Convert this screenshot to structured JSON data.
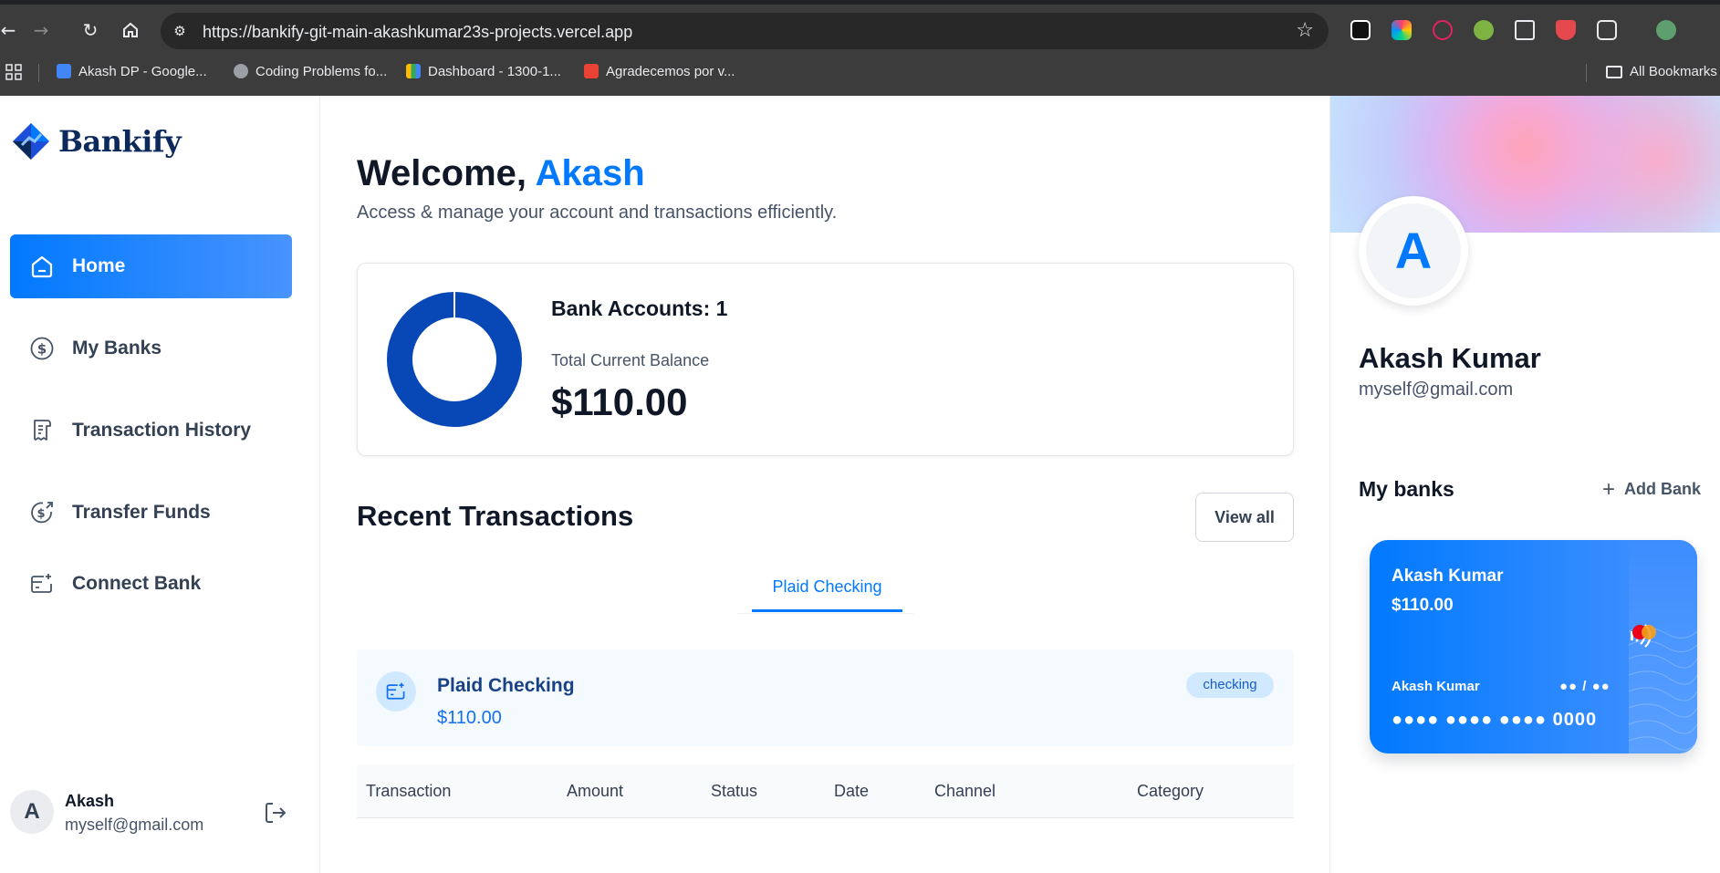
{
  "browser": {
    "url": "https://bankify-git-main-akashkumar23s-projects.vercel.app",
    "bookmarks": [
      {
        "label": "Akash DP - Google..."
      },
      {
        "label": "Coding Problems fo..."
      },
      {
        "label": "Dashboard - 1300-1..."
      },
      {
        "label": "Agradecemos por v..."
      }
    ],
    "all_bookmarks": "All Bookmarks"
  },
  "sidebar": {
    "brand": "Bankify",
    "items": [
      {
        "label": "Home",
        "icon": "home-icon",
        "active": true
      },
      {
        "label": "My Banks",
        "icon": "dollar-circle-icon"
      },
      {
        "label": "Transaction History",
        "icon": "receipt-icon"
      },
      {
        "label": "Transfer Funds",
        "icon": "money-send-icon"
      },
      {
        "label": "Connect Bank",
        "icon": "card-add-icon"
      }
    ],
    "user": {
      "initial": "A",
      "name": "Akash",
      "email": "myself@gmail.com"
    }
  },
  "main": {
    "greeting": "Welcome,",
    "user_first_name": "Akash",
    "subtext": "Access & manage your account and transactions efficiently.",
    "balance": {
      "accounts_label": "Bank Accounts: 1",
      "total_label": "Total Current Balance",
      "total_amount": "$110.00"
    },
    "recent": {
      "title": "Recent Transactions",
      "view_all": "View all",
      "tabs": [
        {
          "label": "Plaid Checking",
          "active": true
        }
      ],
      "account": {
        "name": "Plaid Checking",
        "amount": "$110.00",
        "badge": "checking"
      },
      "columns": [
        "Transaction",
        "Amount",
        "Status",
        "Date",
        "Channel",
        "Category"
      ]
    }
  },
  "right": {
    "avatar_initial": "A",
    "name": "Akash Kumar",
    "email": "myself@gmail.com",
    "my_banks_title": "My banks",
    "add_bank": "Add Bank",
    "card": {
      "bank_name": "Akash Kumar",
      "balance": "$110.00",
      "holder": "Akash Kumar",
      "expiry": "●● / ●●",
      "number": "●●●● ●●●● ●●●● 0000"
    }
  },
  "colors": {
    "accent": "#0179fe",
    "donut": "#0747b6",
    "text_dark": "#101828",
    "text_muted": "#475467"
  }
}
